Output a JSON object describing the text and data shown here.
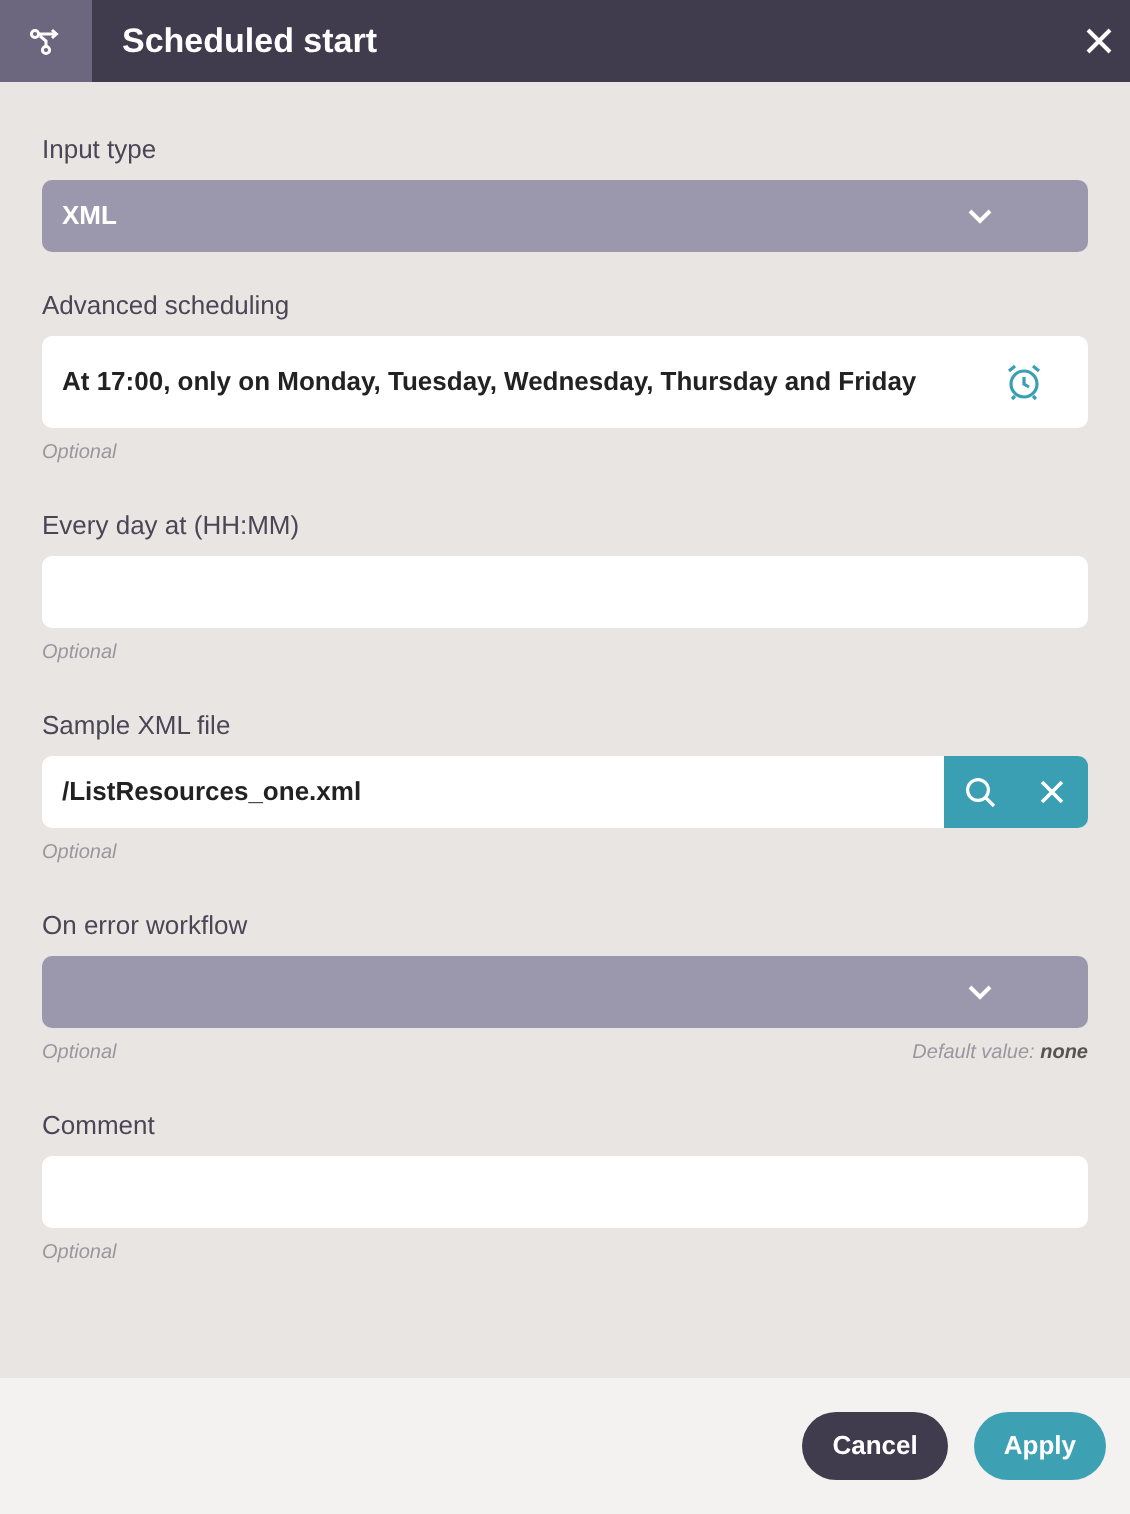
{
  "window": {
    "title": "Scheduled start"
  },
  "fields": [
    {
      "kind": "select",
      "label": "Input type",
      "value": "XML"
    },
    {
      "kind": "schedule",
      "label": "Advanced scheduling",
      "value": "At 17:00, only on Monday, Tuesday, Wednesday, Thursday and Friday",
      "hint": "Optional"
    },
    {
      "kind": "text",
      "label": "Every day at (HH:MM)",
      "hint": "Optional"
    },
    {
      "kind": "file",
      "label": "Sample XML file",
      "value": "/ListResources_one.xml",
      "hint": "Optional"
    },
    {
      "kind": "select",
      "label": "On error workflow",
      "hint": "Optional",
      "default_note": "Default value: **none**"
    },
    {
      "kind": "text",
      "label": "Comment",
      "hint": "Optional"
    }
  ],
  "buttons": [
    {
      "kind": "secondary",
      "label": "Cancel"
    },
    {
      "kind": "primary",
      "label": "Apply"
    }
  ]
}
